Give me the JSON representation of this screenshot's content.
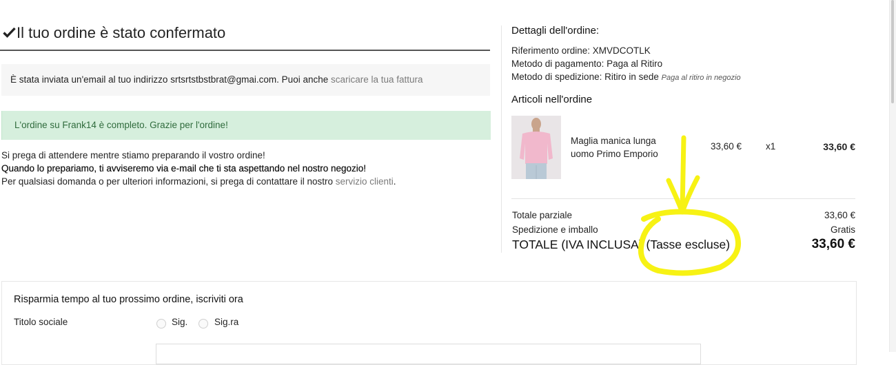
{
  "confirmation": {
    "title": "Il tuo ordine è stato confermato",
    "email_text": "È stata inviata un'email al tuo indirizzo srtsrtstbstbrat@gmai.com. Puoi anche ",
    "invoice_link": "scaricare la tua fattura",
    "success_message": "L'ordine su Frank14 è completo. Grazie per l'ordine!",
    "info_line1": "Si prega di attendere mentre stiamo preparando il vostro ordine!",
    "info_line2": "Quando lo prepariamo, ti avviseremo via e-mail che ti sta aspettando nel nostro negozio!",
    "info_line3_prefix": "Per qualsiasi domanda o per ulteriori informazioni, si prega di contattare il nostro ",
    "service_link": "servizio clienti",
    "info_line3_suffix": "."
  },
  "order_details": {
    "heading": "Dettagli dell'ordine:",
    "reference": "Riferimento ordine: XMVDCOTLK",
    "payment": "Metodo di pagamento: Paga al Ritiro",
    "shipping": "Metodo di spedizione: Ritiro in sede",
    "shipping_note": "Paga al ritiro in negozio",
    "items_heading": "Articoli nell'ordine",
    "items": [
      {
        "name_line1": "Maglia manica lunga",
        "name_line2": "uomo Primo Emporio",
        "unit_price": "33,60 €",
        "quantity": "x1",
        "total": "33,60 €"
      }
    ],
    "subtotal_label": "Totale parziale",
    "subtotal_value": "33,60 €",
    "shipping_label": "Spedizione e imballo",
    "shipping_value": "Gratis",
    "grand_total_label": "TOTALE (IVA INCLUSA) (Tasse escluse)",
    "grand_total_value": "33,60 €"
  },
  "guest_form": {
    "title": "Risparmia tempo al tuo prossimo ordine, iscriviti ora",
    "title_label": "Titolo sociale",
    "options": [
      "Sig.",
      "Sig.ra"
    ]
  },
  "colors": {
    "success_bg": "#d6efdd",
    "success_text": "#2f6b3c",
    "annotation": "#f7f214"
  },
  "icons": {
    "check": "check-icon",
    "annotation": "arrow-circle-annotation"
  }
}
